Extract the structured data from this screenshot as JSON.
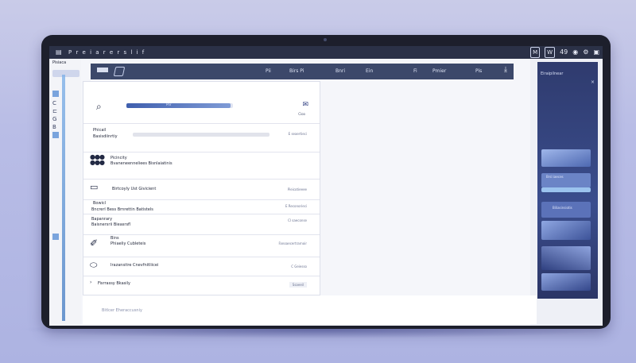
{
  "os_bar": {
    "menu_icon": "grid-icon",
    "title": "P r e i a r e r s l i f",
    "right": {
      "mail_badge": "M",
      "wifi": "W",
      "clock": "49",
      "icons": [
        "user-icon",
        "settings-icon",
        "battery-icon"
      ]
    }
  },
  "rail": {
    "header": "Pisiaca",
    "items": [
      "C",
      "⊏",
      "G",
      "B"
    ]
  },
  "header": {
    "items": [
      "Pii",
      "Birs Pi",
      "Bnri",
      "Ein",
      "Fi",
      "Pmier",
      "Pis"
    ],
    "logo": "app-logo"
  },
  "settings": {
    "search": {
      "icon": "search-icon",
      "progress_label": "Pnr",
      "progress": 0.98
    },
    "top_action": "Cioo",
    "rows": [
      {
        "title": "Phicail",
        "subtitle": "Basisdiinrtiy",
        "action": "E seaertieci",
        "icon": "toggle-icon"
      },
      {
        "title": "Picincity",
        "subtitle": "Bvaneneenneliees Bisnlaiatinis",
        "action": "",
        "icon": "dots-icon"
      },
      {
        "title": "Birtcoyly Ust Givicient",
        "subtitle": "",
        "action": "Pieicotieeee",
        "icon": "window-icon"
      },
      {
        "title": "Bowicl",
        "subtitle": "Bncrerl Bess Brnrettin Batistels",
        "action": "E Reconorieci",
        "icon": ""
      },
      {
        "title": "Bapanrary",
        "subtitle": "Baisnersrii Bieasrsfl",
        "action": "Cl saeconse",
        "icon": ""
      },
      {
        "title": "Bins",
        "subtitle": "Phiaeliy Cubleteis",
        "action": "Fanoaecertrarnoir",
        "icon": "pen-icon"
      },
      {
        "title": "Irazansitre Cnevfnitliicei",
        "subtitle": "",
        "action": "C Geiesso",
        "icon": "tag-icon"
      },
      {
        "title": "Fisrrassy Bkasily",
        "subtitle": "",
        "action": "Ssaeeil",
        "icon": "chevron-right-icon"
      }
    ]
  },
  "footer": {
    "text": "Bitlcer   Eheraccusniy"
  },
  "preview": {
    "header": "Eiraipilnear",
    "close": "×",
    "bar_label": "Brsl iaeces",
    "level_label": "Biliasinsiotis"
  }
}
